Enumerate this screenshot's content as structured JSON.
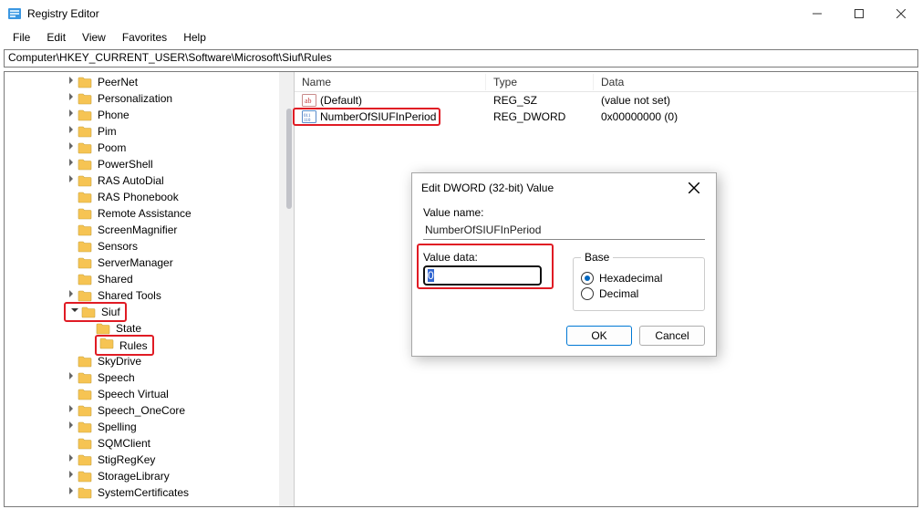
{
  "window": {
    "title": "Registry Editor"
  },
  "menu": {
    "file": "File",
    "edit": "Edit",
    "view": "View",
    "favorites": "Favorites",
    "help": "Help"
  },
  "address": "Computer\\HKEY_CURRENT_USER\\Software\\Microsoft\\Siuf\\Rules",
  "tree": [
    {
      "indent": 3,
      "exp": ">",
      "label": "PeerNet"
    },
    {
      "indent": 3,
      "exp": ">",
      "label": "Personalization"
    },
    {
      "indent": 3,
      "exp": ">",
      "label": "Phone"
    },
    {
      "indent": 3,
      "exp": ">",
      "label": "Pim"
    },
    {
      "indent": 3,
      "exp": ">",
      "label": "Poom"
    },
    {
      "indent": 3,
      "exp": ">",
      "label": "PowerShell"
    },
    {
      "indent": 3,
      "exp": ">",
      "label": "RAS AutoDial"
    },
    {
      "indent": 3,
      "exp": "",
      "label": "RAS Phonebook"
    },
    {
      "indent": 3,
      "exp": "",
      "label": "Remote Assistance"
    },
    {
      "indent": 3,
      "exp": "",
      "label": "ScreenMagnifier"
    },
    {
      "indent": 3,
      "exp": "",
      "label": "Sensors"
    },
    {
      "indent": 3,
      "exp": "",
      "label": "ServerManager"
    },
    {
      "indent": 3,
      "exp": "",
      "label": "Shared"
    },
    {
      "indent": 3,
      "exp": ">",
      "label": "Shared Tools"
    },
    {
      "indent": 3,
      "exp": "v",
      "label": "Siuf",
      "hl": true
    },
    {
      "indent": 4,
      "exp": "",
      "label": "State"
    },
    {
      "indent": 4,
      "exp": "",
      "label": "Rules",
      "hl": true
    },
    {
      "indent": 3,
      "exp": "",
      "label": "SkyDrive"
    },
    {
      "indent": 3,
      "exp": ">",
      "label": "Speech"
    },
    {
      "indent": 3,
      "exp": "",
      "label": "Speech Virtual"
    },
    {
      "indent": 3,
      "exp": ">",
      "label": "Speech_OneCore"
    },
    {
      "indent": 3,
      "exp": ">",
      "label": "Spelling"
    },
    {
      "indent": 3,
      "exp": "",
      "label": "SQMClient"
    },
    {
      "indent": 3,
      "exp": ">",
      "label": "StigRegKey"
    },
    {
      "indent": 3,
      "exp": ">",
      "label": "StorageLibrary"
    },
    {
      "indent": 3,
      "exp": ">",
      "label": "SystemCertificates"
    }
  ],
  "list": {
    "columns": {
      "name": "Name",
      "type": "Type",
      "data": "Data"
    },
    "rows": [
      {
        "icon": "sz",
        "name": "(Default)",
        "type": "REG_SZ",
        "data": "(value not set)"
      },
      {
        "icon": "dw",
        "name": "NumberOfSIUFInPeriod",
        "type": "REG_DWORD",
        "data": "0x00000000 (0)",
        "hl": true
      }
    ]
  },
  "dialog": {
    "title": "Edit DWORD (32-bit) Value",
    "valueNameLabel": "Value name:",
    "valueName": "NumberOfSIUFInPeriod",
    "valueDataLabel": "Value data:",
    "valueData": "0",
    "baseLabel": "Base",
    "hex": "Hexadecimal",
    "dec": "Decimal",
    "ok": "OK",
    "cancel": "Cancel",
    "baseSelected": "hex"
  }
}
